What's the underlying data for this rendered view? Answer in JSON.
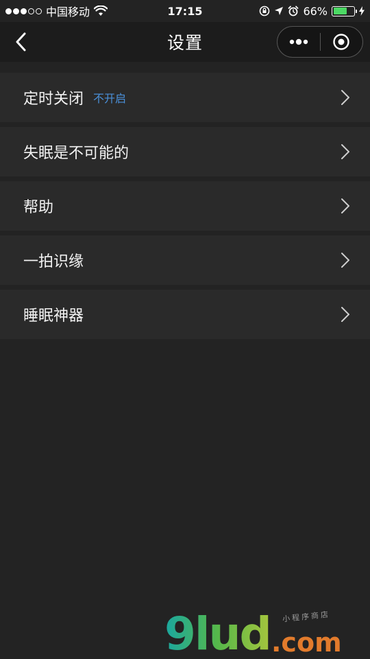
{
  "status_bar": {
    "carrier": "中国移动",
    "time": "17:15",
    "battery_percent": "66%",
    "battery_level": 0.66,
    "signal_filled": 3,
    "signal_total": 5
  },
  "nav": {
    "title": "设置",
    "icons": {
      "back": "chevron-left-icon",
      "more": "more-dots-icon",
      "close": "target-close-icon"
    }
  },
  "settings": {
    "items": [
      {
        "label": "定时关闭",
        "value": "不开启"
      },
      {
        "label": "失眠是不可能的"
      },
      {
        "label": "帮助"
      },
      {
        "label": "一拍识缘"
      },
      {
        "label": "睡眠神器"
      }
    ]
  },
  "watermark": {
    "brand": "9lud",
    "suffix": ".com",
    "tagline": "小程序商店"
  },
  "colors": {
    "background": "#232323",
    "nav_background": "#1c1c1c",
    "item_background": "#2a2a2a",
    "value_accent": "#4a90d9",
    "battery_fill": "#4cd964"
  }
}
